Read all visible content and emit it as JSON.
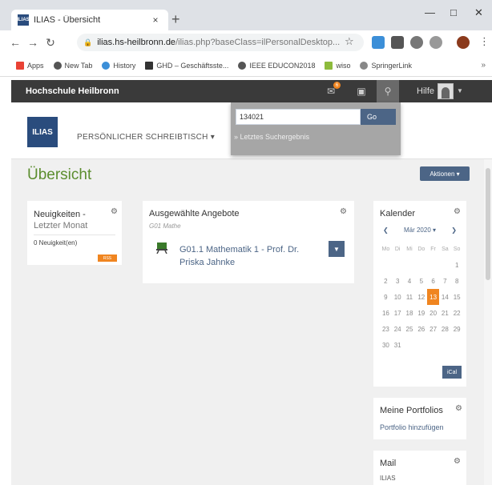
{
  "browser": {
    "tab_title": "ILIAS - Übersicht",
    "tab_close": "×",
    "new_tab": "+",
    "favicon_text": "ILIAS",
    "url_domain": "ilias.hs-heilbronn.de",
    "url_rest": "/ilias.php?baseClass=ilPersonalDesktop...",
    "bookmarks": [
      "Apps",
      "New Tab",
      "History",
      "GHD – Geschäftsste...",
      "IEEE EDUCON2018",
      "wiso",
      "SpringerLink"
    ],
    "bookmarks_more": "»"
  },
  "topbar": {
    "brand": "Hochschule Heilbronn",
    "mail_badge": "6",
    "help": "Hilfe"
  },
  "header": {
    "logo": "ILIAS",
    "nav": "PERSÖNLICHER SCHREIBTISCH ▾"
  },
  "search": {
    "value": "134021",
    "go": "Go",
    "last_search": "» Letztes Suchergebnis"
  },
  "page": {
    "title": "Übersicht",
    "actions": "Aktionen ▾"
  },
  "news": {
    "title": "Neuigkeiten -",
    "subtitle": "Letzter Monat",
    "count": "0 Neuigkeit(en)",
    "rss": "RSS"
  },
  "offers": {
    "title": "Ausgewählte Angebote",
    "sub": "G01 Mathe",
    "course": "G01.1 Mathematik 1 - Prof. Dr. Priska Jahnke"
  },
  "calendar": {
    "title": "Kalender",
    "prev": "❮",
    "month": "Mär 2020 ▾",
    "next": "❯",
    "weekdays": [
      "Mo",
      "Di",
      "Mi",
      "Do",
      "Fr",
      "Sa",
      "So"
    ],
    "days": [
      "",
      "",
      "",
      "",
      "",
      "",
      "1",
      "2",
      "3",
      "4",
      "5",
      "6",
      "7",
      "8",
      "9",
      "10",
      "11",
      "12",
      "13",
      "14",
      "15",
      "16",
      "17",
      "18",
      "19",
      "20",
      "21",
      "22",
      "23",
      "24",
      "25",
      "26",
      "27",
      "28",
      "29",
      "30",
      "31"
    ],
    "today": "13",
    "ical": "iCal"
  },
  "portfolios": {
    "title": "Meine Portfolios",
    "link": "Portfolio hinzufügen"
  },
  "mail": {
    "title": "Mail",
    "sub": "ILIAS"
  },
  "colors": {
    "accent_blue": "#4c6586",
    "title_green": "#5b8d2e",
    "badge_orange": "#f08520",
    "topbar": "#3a3a3a"
  }
}
